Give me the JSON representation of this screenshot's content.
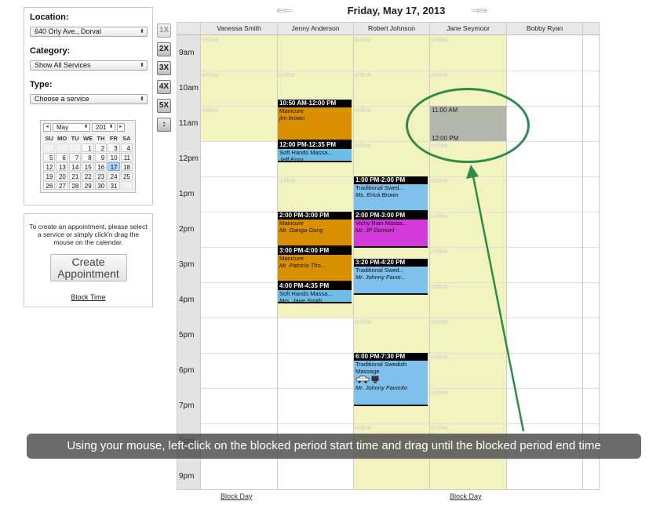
{
  "sidebar": {
    "location_label": "Location:",
    "location_value": "640 Orly Ave., Dorval",
    "category_label": "Category:",
    "category_value": "Show All Services",
    "type_label": "Type:",
    "type_value": "Choose a service",
    "mini_calendar": {
      "month": "May",
      "year": "201",
      "prev": "◄",
      "next": "►",
      "weekdays": [
        "SU",
        "MO",
        "TU",
        "WE",
        "TH",
        "FR",
        "SA"
      ],
      "weeks": [
        [
          "",
          "",
          "",
          "1",
          "2",
          "3",
          "4"
        ],
        [
          "5",
          "6",
          "7",
          "8",
          "9",
          "10",
          "11"
        ],
        [
          "12",
          "13",
          "14",
          "15",
          "16",
          "17",
          "18"
        ],
        [
          "19",
          "20",
          "21",
          "22",
          "23",
          "24",
          "25"
        ],
        [
          "26",
          "27",
          "28",
          "29",
          "30",
          "31",
          ""
        ]
      ],
      "selected_day": "17"
    },
    "info_text": "To create an appointment, please select a service or simply click'n drag the mouse on the calendar.",
    "create_button": "Create Appointment",
    "block_time_link": "Block Time"
  },
  "zoom_buttons": [
    "1X",
    "2X",
    "3X",
    "4X",
    "5X",
    "↕"
  ],
  "header": {
    "date_title": "Friday, May 17, 2013",
    "prev_arrows": "⇚ ⇐",
    "next_arrows": "⇒ ⇛"
  },
  "calendar": {
    "columns": [
      "Vanessa Smith",
      "Jenny Anderson",
      "Robert Johnson",
      "Jane Seymoor",
      "Bobby Ryan"
    ],
    "hours": [
      "9am",
      "10am",
      "11am",
      "12pm",
      "1pm",
      "2pm",
      "3pm",
      "4pm",
      "5pm",
      "6pm",
      "7pm",
      "8pm",
      "9pm"
    ],
    "online_label": "online",
    "appointments": [
      {
        "time": "10:50 AM-12:00 PM",
        "service": "Manicure",
        "client": "jim brown",
        "color": "#d99000"
      },
      {
        "time": "12:00 PM-12:35 PM",
        "service": "Soft Hands Massa...",
        "client": "Jeff Error",
        "color": "#6ebde9"
      },
      {
        "time": "1:00 PM-2:00 PM",
        "service": "Traditional Swed...",
        "client": "Ms. Ericà Brown",
        "color": "#7fc0ec"
      },
      {
        "time": "2:00 PM-3:00 PM",
        "service": "Manicure",
        "client": "Mr. Ganga Gong",
        "color": "#d99000"
      },
      {
        "time": "2:00 PM-3:00 PM",
        "service": "Vichy Rain Massa...",
        "client": "Mr. JP Dumont",
        "color": "#d43ad9"
      },
      {
        "time": "3:00 PM-4:00 PM",
        "service": "Manicure",
        "client": "Mr. Patricia Tho...",
        "color": "#d99000"
      },
      {
        "time": "3:20 PM-4:20 PM",
        "service": "Traditional Swed...",
        "client": "Mr. Johnny Favor...",
        "color": "#7fc0ec"
      },
      {
        "time": "4:00 PM-4:35 PM",
        "service": "Soft Hands Massa...",
        "client": "Mrs. Jane Smith",
        "color": "#6ebde9"
      },
      {
        "time": "6:00 PM-7:30 PM",
        "service": "Traditional Swedish Massage",
        "client": "Mr. Johnny Favorito",
        "color": "#7fc0ec"
      }
    ],
    "blocked_period": {
      "start": "11:00 AM",
      "end": "12:00 PM",
      "color": "#b4b7ab"
    },
    "block_day_label": "Block Day"
  },
  "tooltip": "Using your mouse, left-click on the blocked period start time and drag until the blocked period end time",
  "colors": {
    "callout": "#2e8c46",
    "availability": "#f3f3c0"
  }
}
